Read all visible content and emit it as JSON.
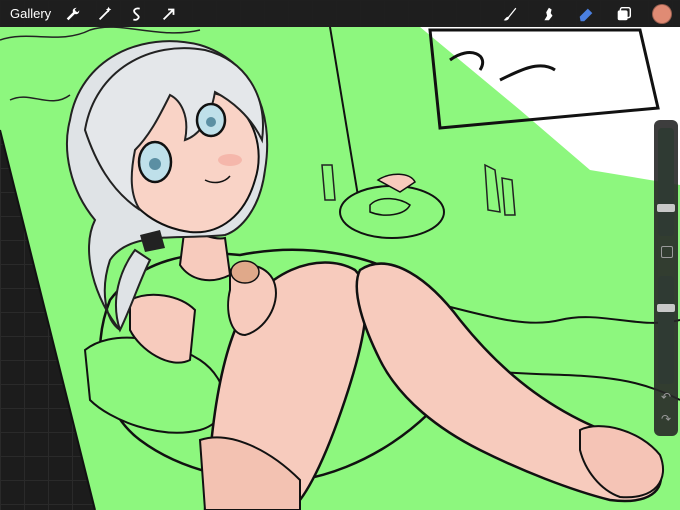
{
  "topbar": {
    "gallery_label": "Gallery",
    "left_tools": [
      "wrench-icon",
      "magic-wand-icon",
      "selection-icon",
      "transform-arrow-icon"
    ],
    "right_tools": [
      "brush-icon",
      "smudge-icon",
      "eraser-icon",
      "layers-icon"
    ],
    "active_tool": "eraser-icon",
    "current_color": "#e08b74"
  },
  "sidebar": {
    "brush_size_level": 0.27,
    "opacity_level": 0.3
  },
  "canvas": {
    "background_color": "#8df77e",
    "accent_color": "#4a7fe0"
  }
}
